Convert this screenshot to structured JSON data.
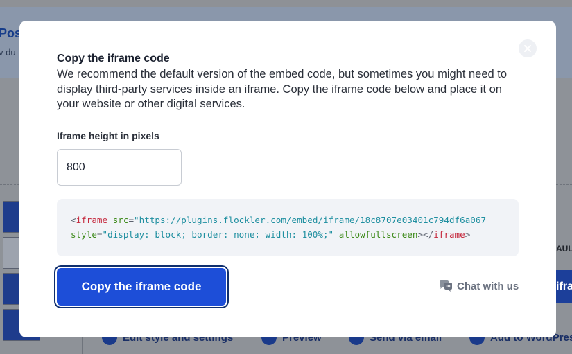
{
  "background": {
    "banner_title": "Pos",
    "banner_subtitle": "v du",
    "right_label": "AUL",
    "right_button": "ifra",
    "actions": [
      {
        "label": "Edit style and settings"
      },
      {
        "label": "Preview"
      },
      {
        "label": "Send via email"
      },
      {
        "label": "Add to WordPress"
      }
    ]
  },
  "modal": {
    "title": "Copy the iframe code",
    "description": "We recommend the default version of the embed code, but sometimes you might need to display third-party services inside an iframe. Copy the iframe code below and place it on your website or other digital services.",
    "height_label": "Iframe height in pixels",
    "height_value": "800",
    "code": {
      "line1": {
        "open": "<",
        "tag": "iframe",
        "attr": "src",
        "eq": "=",
        "value": "\"https://plugins.flockler.com/embed/iframe/18c8707e03401c794df6a067"
      },
      "line2": {
        "attr": "style",
        "eq": "=",
        "value": "\"display: block; border: none; width: 100%;\"",
        "attr2": "allowfullscreen",
        "close1": "></",
        "tag": "iframe",
        "close2": ">"
      }
    },
    "copy_button": "Copy the iframe code",
    "chat_link": "Chat with us"
  },
  "colors": {
    "primary": "#1d4ed8",
    "tag": "#c5283d",
    "attr": "#3d8a1a",
    "string": "#1f8fa0"
  }
}
